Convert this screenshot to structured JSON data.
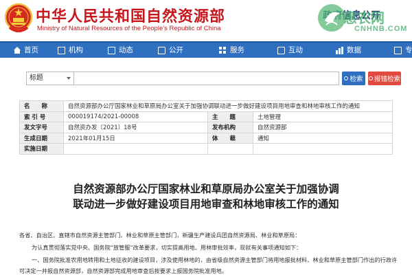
{
  "header": {
    "site_title": "中华人民共和国自然资源部",
    "site_subtitle": "Ministry of Natural Resources of the People’s Republic of China",
    "portal_title": "政府信息公开",
    "watermark_text": "惠农网",
    "watermark_sub": "CNHNB.COM",
    "accent_color": "#c8161d"
  },
  "nav": {
    "bg_color": "#2e6fc0",
    "items": [
      {
        "label": "首页",
        "icon": "home-icon"
      },
      {
        "label": "机构",
        "icon": "org-icon"
      },
      {
        "label": "动态",
        "icon": "news-icon"
      },
      {
        "label": "公开",
        "icon": "disclosure-icon"
      },
      {
        "label": "服务",
        "icon": "service-icon"
      },
      {
        "label": "互动",
        "icon": "interaction-icon"
      },
      {
        "label": "数据",
        "icon": "data-icon"
      },
      {
        "label": "专题",
        "icon": "topic-icon"
      }
    ]
  },
  "search": {
    "select_value": "标题",
    "input_value": "",
    "search_label": "检索",
    "report_label": "报错检索"
  },
  "info": {
    "name_key": "名　　称",
    "name_value": "自然资源部办公厅国家林业和草原局办公室关于加强协调联动进一步做好建设项目用地审查和林地审核工作的通知",
    "index_key": "索 引 号",
    "index_value": "000019174/2021-00008",
    "topic_key": "主　　题",
    "topic_value": "土地管理",
    "docno_key": "发文字号",
    "docno_value": "自然资办发〔2021〕18号",
    "issuer_key": "发布机构",
    "issuer_value": "自然资源部",
    "date_key": "生成日期",
    "date_value": "2021年01月15日",
    "genre_key": "体　　裁",
    "genre_value": "通知",
    "effective_key": "实施日期",
    "effective_value": ""
  },
  "article": {
    "title": "自然资源部办公厅国家林业和草原局办公室关于加强协调联动进一步做好建设项目用地审查和林地审核工作的通知",
    "addressee": "各省、自治区、直辖市自然资源主管部门、林业和草原主管部门，新疆生产建设兵团自然资源局、林业和草原局：",
    "para1": "为认真贯彻落实党中央、国务院“放管服”改革要求，切实提高用地、用林审批效率，现就有关事项通知如下：",
    "para2_line1": "一、国务院批准农用地转用和土地征收的建设项目，涉及使用林地的，由省级自然资源主管部门将用地报批材料、林业和草原主管部门作出的行政许",
    "para2_line2": "可决定一并报自然资源部，自然资源部完成用地审查后按要求上报国务院批准用地。"
  }
}
